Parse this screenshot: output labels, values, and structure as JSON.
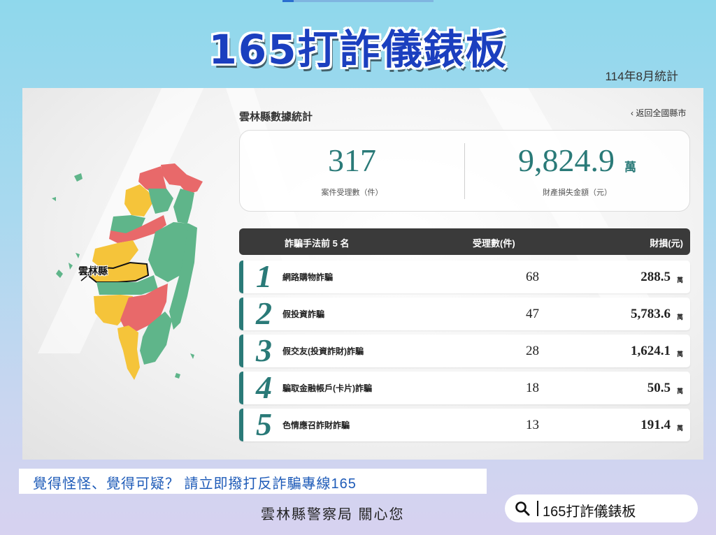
{
  "banner": {
    "title": "165打詐儀錶板",
    "stat_month": "114年8月統計"
  },
  "county": {
    "title": "雲林縣數據統計",
    "back_link": "返回全國縣市",
    "map_label": "雲林縣"
  },
  "summary": {
    "cases": {
      "value": "317",
      "label": "案件受理數（件）"
    },
    "loss": {
      "value": "9,824.9",
      "unit": "萬",
      "label": "財產損失金額（元）"
    }
  },
  "table": {
    "headers": {
      "method": "詐騙手法前 5 名",
      "count": "受理數(件)",
      "loss": "財損(元)"
    },
    "rows": [
      {
        "rank": "1",
        "method": "網路購物詐騙",
        "count": "68",
        "loss": "288.5",
        "unit": "萬"
      },
      {
        "rank": "2",
        "method": "假投資詐騙",
        "count": "47",
        "loss": "5,783.6",
        "unit": "萬"
      },
      {
        "rank": "3",
        "method": "假交友(投資詐財)詐騙",
        "count": "28",
        "loss": "1,624.1",
        "unit": "萬"
      },
      {
        "rank": "4",
        "method": "騙取金融帳戶(卡片)詐騙",
        "count": "18",
        "loss": "50.5",
        "unit": "萬"
      },
      {
        "rank": "5",
        "method": "色情應召詐財詐騙",
        "count": "13",
        "loss": "191.4",
        "unit": "萬"
      }
    ]
  },
  "footer": {
    "note": "覺得怪怪、覺得可疑？  請立即撥打反詐騙專線165",
    "station": "雲林縣警察局  關心您",
    "search_text": "165打詐儀錶板",
    "search_icon": "search-icon"
  },
  "colors": {
    "accent": "#2a7a78",
    "map_red": "#e8696a",
    "map_yellow": "#f5c43a",
    "map_green": "#5fb58a",
    "title_blue": "#1b3fbf",
    "note_blue": "#1e5bb8"
  }
}
